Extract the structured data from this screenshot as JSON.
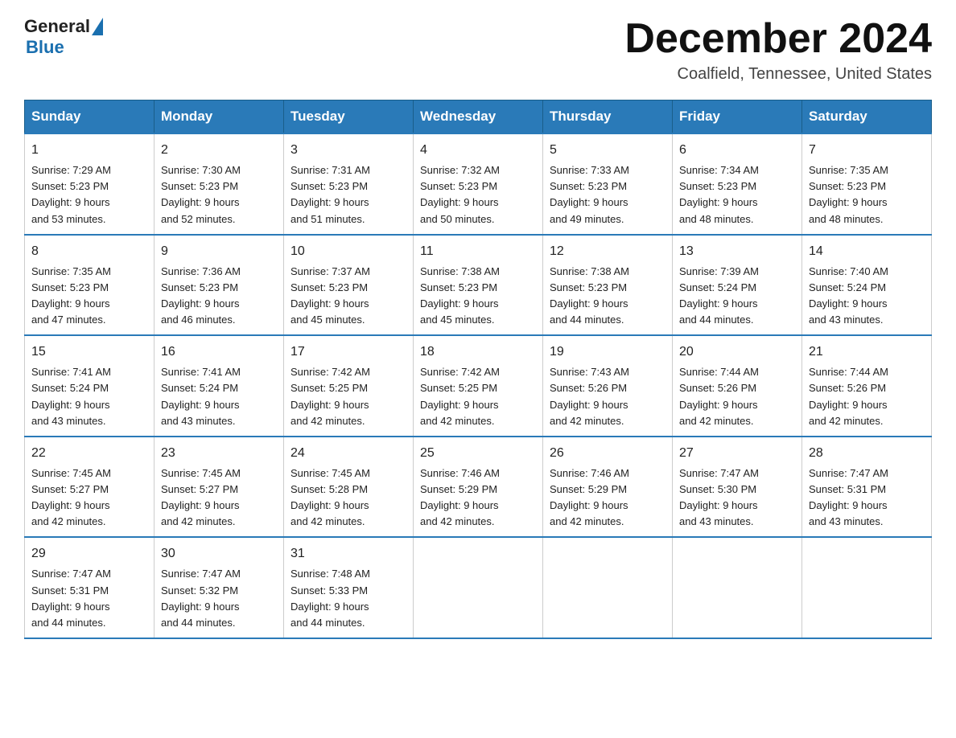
{
  "header": {
    "logo": {
      "general": "General",
      "blue": "Blue"
    },
    "title": "December 2024",
    "location": "Coalfield, Tennessee, United States"
  },
  "weekdays": [
    "Sunday",
    "Monday",
    "Tuesday",
    "Wednesday",
    "Thursday",
    "Friday",
    "Saturday"
  ],
  "weeks": [
    [
      {
        "day": "1",
        "sunrise": "7:29 AM",
        "sunset": "5:23 PM",
        "daylight": "9 hours and 53 minutes."
      },
      {
        "day": "2",
        "sunrise": "7:30 AM",
        "sunset": "5:23 PM",
        "daylight": "9 hours and 52 minutes."
      },
      {
        "day": "3",
        "sunrise": "7:31 AM",
        "sunset": "5:23 PM",
        "daylight": "9 hours and 51 minutes."
      },
      {
        "day": "4",
        "sunrise": "7:32 AM",
        "sunset": "5:23 PM",
        "daylight": "9 hours and 50 minutes."
      },
      {
        "day": "5",
        "sunrise": "7:33 AM",
        "sunset": "5:23 PM",
        "daylight": "9 hours and 49 minutes."
      },
      {
        "day": "6",
        "sunrise": "7:34 AM",
        "sunset": "5:23 PM",
        "daylight": "9 hours and 48 minutes."
      },
      {
        "day": "7",
        "sunrise": "7:35 AM",
        "sunset": "5:23 PM",
        "daylight": "9 hours and 48 minutes."
      }
    ],
    [
      {
        "day": "8",
        "sunrise": "7:35 AM",
        "sunset": "5:23 PM",
        "daylight": "9 hours and 47 minutes."
      },
      {
        "day": "9",
        "sunrise": "7:36 AM",
        "sunset": "5:23 PM",
        "daylight": "9 hours and 46 minutes."
      },
      {
        "day": "10",
        "sunrise": "7:37 AM",
        "sunset": "5:23 PM",
        "daylight": "9 hours and 45 minutes."
      },
      {
        "day": "11",
        "sunrise": "7:38 AM",
        "sunset": "5:23 PM",
        "daylight": "9 hours and 45 minutes."
      },
      {
        "day": "12",
        "sunrise": "7:38 AM",
        "sunset": "5:23 PM",
        "daylight": "9 hours and 44 minutes."
      },
      {
        "day": "13",
        "sunrise": "7:39 AM",
        "sunset": "5:24 PM",
        "daylight": "9 hours and 44 minutes."
      },
      {
        "day": "14",
        "sunrise": "7:40 AM",
        "sunset": "5:24 PM",
        "daylight": "9 hours and 43 minutes."
      }
    ],
    [
      {
        "day": "15",
        "sunrise": "7:41 AM",
        "sunset": "5:24 PM",
        "daylight": "9 hours and 43 minutes."
      },
      {
        "day": "16",
        "sunrise": "7:41 AM",
        "sunset": "5:24 PM",
        "daylight": "9 hours and 43 minutes."
      },
      {
        "day": "17",
        "sunrise": "7:42 AM",
        "sunset": "5:25 PM",
        "daylight": "9 hours and 42 minutes."
      },
      {
        "day": "18",
        "sunrise": "7:42 AM",
        "sunset": "5:25 PM",
        "daylight": "9 hours and 42 minutes."
      },
      {
        "day": "19",
        "sunrise": "7:43 AM",
        "sunset": "5:26 PM",
        "daylight": "9 hours and 42 minutes."
      },
      {
        "day": "20",
        "sunrise": "7:44 AM",
        "sunset": "5:26 PM",
        "daylight": "9 hours and 42 minutes."
      },
      {
        "day": "21",
        "sunrise": "7:44 AM",
        "sunset": "5:26 PM",
        "daylight": "9 hours and 42 minutes."
      }
    ],
    [
      {
        "day": "22",
        "sunrise": "7:45 AM",
        "sunset": "5:27 PM",
        "daylight": "9 hours and 42 minutes."
      },
      {
        "day": "23",
        "sunrise": "7:45 AM",
        "sunset": "5:27 PM",
        "daylight": "9 hours and 42 minutes."
      },
      {
        "day": "24",
        "sunrise": "7:45 AM",
        "sunset": "5:28 PM",
        "daylight": "9 hours and 42 minutes."
      },
      {
        "day": "25",
        "sunrise": "7:46 AM",
        "sunset": "5:29 PM",
        "daylight": "9 hours and 42 minutes."
      },
      {
        "day": "26",
        "sunrise": "7:46 AM",
        "sunset": "5:29 PM",
        "daylight": "9 hours and 42 minutes."
      },
      {
        "day": "27",
        "sunrise": "7:47 AM",
        "sunset": "5:30 PM",
        "daylight": "9 hours and 43 minutes."
      },
      {
        "day": "28",
        "sunrise": "7:47 AM",
        "sunset": "5:31 PM",
        "daylight": "9 hours and 43 minutes."
      }
    ],
    [
      {
        "day": "29",
        "sunrise": "7:47 AM",
        "sunset": "5:31 PM",
        "daylight": "9 hours and 44 minutes."
      },
      {
        "day": "30",
        "sunrise": "7:47 AM",
        "sunset": "5:32 PM",
        "daylight": "9 hours and 44 minutes."
      },
      {
        "day": "31",
        "sunrise": "7:48 AM",
        "sunset": "5:33 PM",
        "daylight": "9 hours and 44 minutes."
      },
      null,
      null,
      null,
      null
    ]
  ],
  "labels": {
    "sunrise": "Sunrise:",
    "sunset": "Sunset:",
    "daylight": "Daylight:"
  }
}
